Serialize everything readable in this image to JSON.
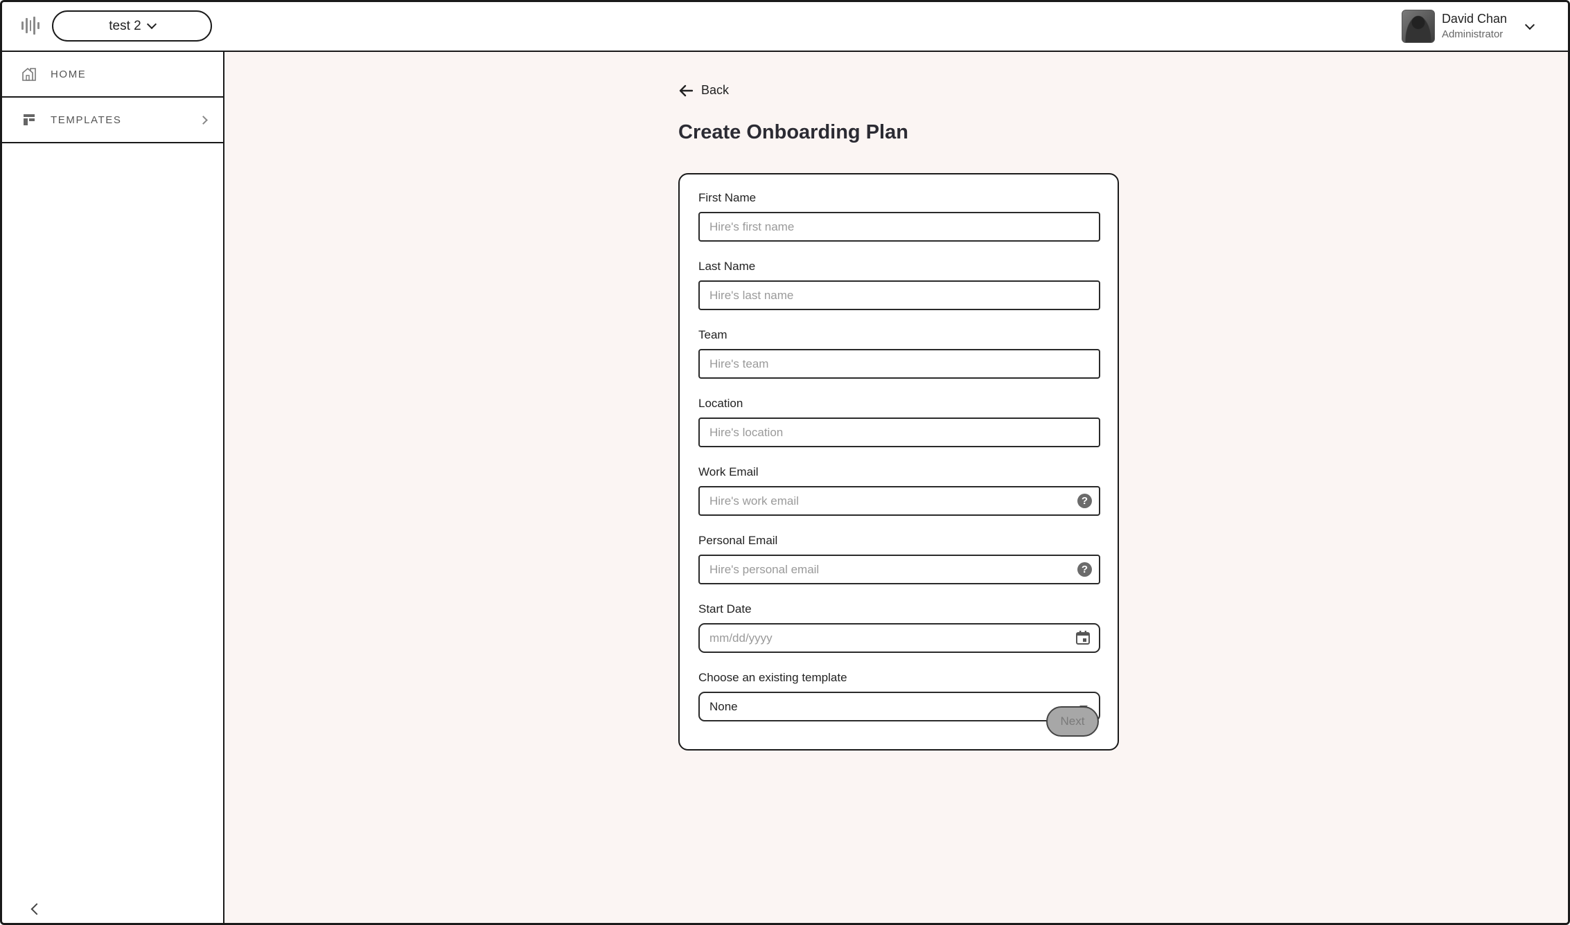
{
  "header": {
    "workspace_name": "test 2",
    "user_name": "David Chan",
    "user_role": "Administrator"
  },
  "sidebar": {
    "items": [
      {
        "label": "HOME",
        "icon": "home-icon"
      },
      {
        "label": "TEMPLATES",
        "icon": "templates-icon"
      }
    ]
  },
  "main": {
    "back_label": "Back",
    "title": "Create Onboarding Plan",
    "form": {
      "first_name": {
        "label": "First Name",
        "placeholder": "Hire's first name",
        "value": ""
      },
      "last_name": {
        "label": "Last Name",
        "placeholder": "Hire's last name",
        "value": ""
      },
      "team": {
        "label": "Team",
        "placeholder": "Hire's team",
        "value": ""
      },
      "location": {
        "label": "Location",
        "placeholder": "Hire's location",
        "value": ""
      },
      "work_email": {
        "label": "Work Email",
        "placeholder": "Hire's work email",
        "value": ""
      },
      "personal_email": {
        "label": "Personal Email",
        "placeholder": "Hire's personal email",
        "value": ""
      },
      "start_date": {
        "label": "Start Date",
        "placeholder": "mm/dd/yyyy",
        "value": ""
      },
      "template": {
        "label": "Choose an existing template",
        "selected": "None"
      },
      "help_glyph": "?",
      "next_label": "Next"
    }
  },
  "colors": {
    "main_bg": "#fbf5f3",
    "border": "#1a1a1a",
    "disabled_button": "#a7a7a7"
  }
}
